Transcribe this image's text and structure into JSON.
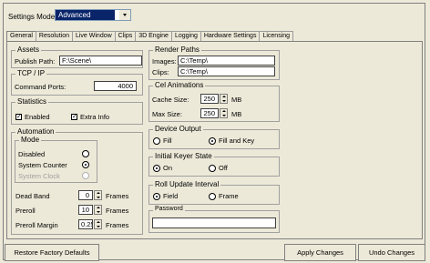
{
  "header": {
    "mode_label": "Settings Mode:",
    "mode_value": "Advanced"
  },
  "tabs": [
    "General",
    "Resolution",
    "Live Window",
    "Clips",
    "3D Engine",
    "Logging",
    "Hardware Settings",
    "Licensing"
  ],
  "assets": {
    "title": "Assets",
    "publish_label": "Publish Path:",
    "publish_value": "F:\\Scene\\"
  },
  "tcpip": {
    "title": "TCP / IP",
    "port_label": "Command Ports:",
    "port_value": "4000"
  },
  "statistics": {
    "title": "Statistics",
    "enabled_label": "Enabled",
    "extra_label": "Extra Info"
  },
  "automation": {
    "title": "Automation",
    "mode_title": "Mode",
    "disabled_label": "Disabled",
    "system_counter_label": "System Counter",
    "system_clock_label": "System Clock",
    "dead_band_label": "Dead Band",
    "dead_band_value": "0",
    "preroll_label": "Preroll",
    "preroll_value": "10",
    "preroll_margin_label": "Preroll Margin",
    "preroll_margin_value": "0.25",
    "frames_label": "Frames"
  },
  "render_paths": {
    "title": "Render Paths",
    "images_label": "Images:",
    "images_value": "C:\\Temp\\",
    "clips_label": "Clips:",
    "clips_value": "C:\\Temp\\"
  },
  "cel_animations": {
    "title": "Cel Animations",
    "cache_label": "Cache Size:",
    "cache_value": "250",
    "max_label": "Max Size:",
    "max_value": "250",
    "unit": "MB"
  },
  "device_output": {
    "title": "Device Output",
    "fill_label": "Fill",
    "fill_key_label": "Fill and Key"
  },
  "keyer": {
    "title": "Initial Keyer State",
    "on_label": "On",
    "off_label": "Off"
  },
  "roll": {
    "title": "Roll Update Interval",
    "field_label": "Field",
    "frame_label": "Frame"
  },
  "password": {
    "title": "Password",
    "value": ""
  },
  "buttons": {
    "restore": "Restore Factory Defaults",
    "apply": "Apply Changes",
    "undo": "Undo Changes"
  }
}
